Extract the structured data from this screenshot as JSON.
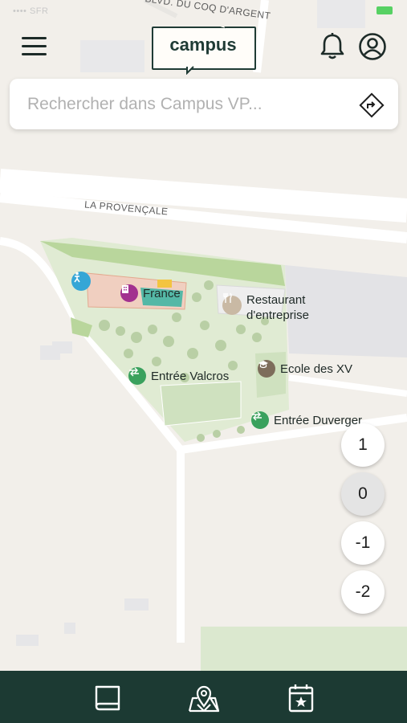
{
  "status_bar": {
    "carrier": "•••• SFR",
    "battery_color": "#57d163"
  },
  "header": {
    "logo_text": "campus",
    "menu_icon": "hamburger-icon",
    "bell_icon": "bell-icon",
    "account_icon": "account-icon"
  },
  "search": {
    "placeholder": "Rechercher dans Campus VP...",
    "value": "",
    "direction_icon": "directions-icon"
  },
  "map": {
    "roads": [
      "BLVD. DU COQ D'ARGENT",
      "LA PROVENÇALE"
    ],
    "pois": [
      {
        "label": "France",
        "icon": "building-icon",
        "color": "#a2308f"
      },
      {
        "label": "Restaurant\nd'entreprise",
        "label_line1": "Restaurant",
        "label_line2": "d'entreprise",
        "icon": "restaurant-icon",
        "color": "#c9b9a4"
      },
      {
        "label": "Ecole des XV",
        "icon": "school-icon",
        "color": "#7d6d5b"
      },
      {
        "label": "Entrée Valcros",
        "icon": "entrance-icon",
        "color": "#3aa15d"
      },
      {
        "label": "Entrée Duverger",
        "icon": "entrance-icon",
        "color": "#3aa15d"
      },
      {
        "label": "",
        "icon": "accessibility-icon",
        "color": "#35a6d6"
      }
    ]
  },
  "floors": {
    "items": [
      "1",
      "0",
      "-1",
      "-2"
    ],
    "active": "0"
  },
  "tabbar": {
    "background": "#1c3a33",
    "tabs": [
      {
        "icon": "book-icon"
      },
      {
        "icon": "map-icon"
      },
      {
        "icon": "calendar-star-icon"
      }
    ]
  },
  "colors": {
    "brand": "#1f3b35",
    "map_background": "#f2efea",
    "park_green": "#d8e6c8"
  }
}
